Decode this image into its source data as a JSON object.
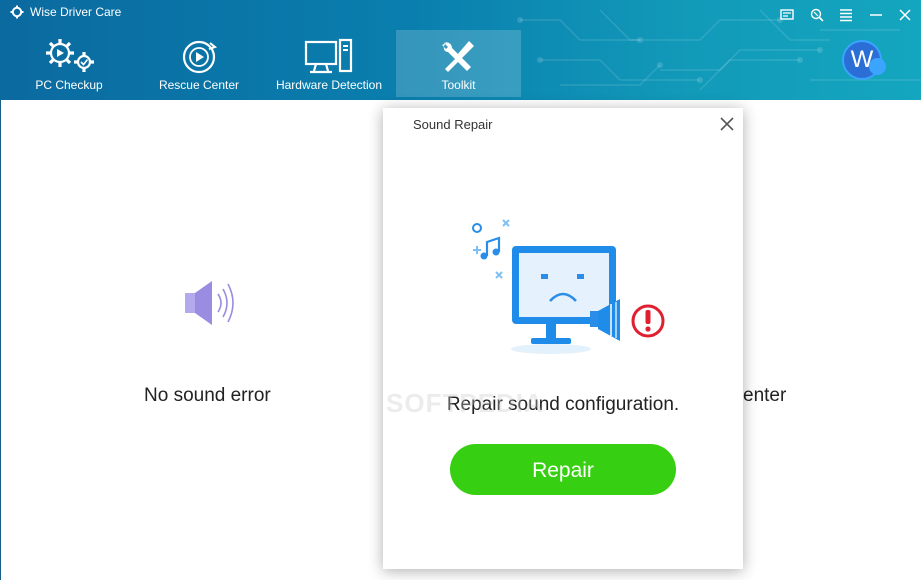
{
  "app": {
    "title": "Wise Driver Care"
  },
  "nav": {
    "tabs": [
      {
        "label": "PC Checkup",
        "icon": "pc-checkup-gears-icon"
      },
      {
        "label": "Rescue Center",
        "icon": "rescue-center-icon"
      },
      {
        "label": "Hardware Detection",
        "icon": "hardware-monitor-tower-icon"
      },
      {
        "label": "Toolkit",
        "icon": "toolkit-tools-icon",
        "active": true
      }
    ]
  },
  "window_controls": [
    "feedback-icon",
    "skin-icon",
    "menu-icon",
    "minimize-icon",
    "close-icon"
  ],
  "user": {
    "avatar_letter": "W"
  },
  "background": {
    "items": [
      {
        "label": "No sound error",
        "icon": "speaker-icon"
      },
      {
        "label": "enter"
      }
    ]
  },
  "dialog": {
    "title": "Sound Repair",
    "message": "Repair sound configuration.",
    "button_label": "Repair",
    "illustration": "sad-monitor-speaker-warning-icon"
  },
  "watermark": "SOFTPEDIA",
  "colors": {
    "header": "#0a7fae",
    "repair_button": "#36cf11",
    "illustration_blue": "#1e8ce8",
    "warning_red": "#e02030",
    "speaker_purple": "#9a8ce0"
  }
}
